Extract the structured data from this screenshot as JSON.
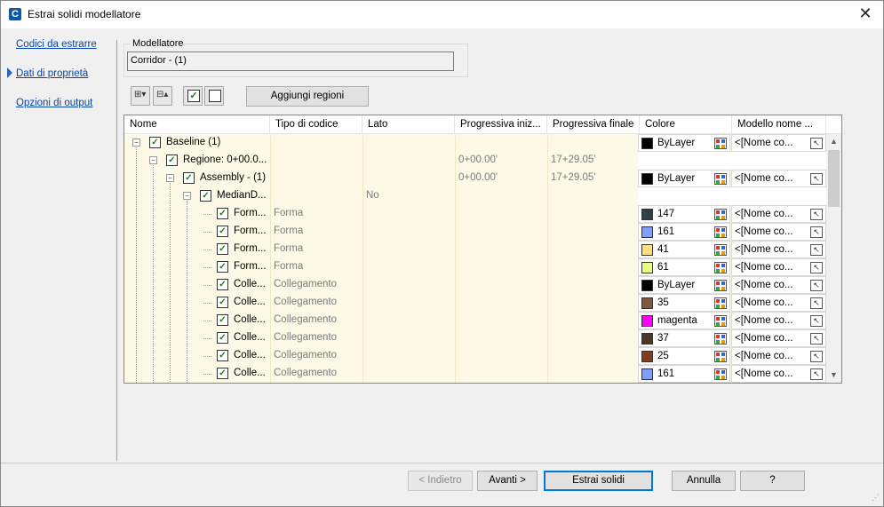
{
  "window": {
    "title": "Estrai solidi modellatore",
    "app_icon_letter": "C",
    "close_glyph": "✕"
  },
  "nav": {
    "items": [
      {
        "label": "Codici da estrarre"
      },
      {
        "label": "Dati di proprietà"
      },
      {
        "label": "Opzioni di output"
      }
    ]
  },
  "modeler": {
    "group_label": "Modellatore",
    "value": "Corridor - (1)"
  },
  "toolbar": {
    "expand_glyph": "⊞▾",
    "collapse_glyph": "⊟▴",
    "check_glyph": "✓",
    "add_regions_label": "Aggiungi regioni"
  },
  "columns": [
    "Nome",
    "Tipo di codice",
    "Lato",
    "Progressiva iniz...",
    "Progressiva finale",
    "Colore",
    "Modello nome ..."
  ],
  "rows": [
    {
      "name": "Baseline (1)",
      "code_type": "",
      "side": "",
      "start": "",
      "end": "",
      "color_name": "ByLayer",
      "color_hex": "#000000",
      "model": "<[Nome co...",
      "has_color": true
    },
    {
      "name": "Regione: 0+00.0...",
      "code_type": "",
      "side": "",
      "start": "0+00.00'",
      "end": "17+29.05'",
      "color_name": "",
      "color_hex": "",
      "model": "",
      "has_color": false
    },
    {
      "name": "Assembly - (1)",
      "code_type": "",
      "side": "",
      "start": "0+00.00'",
      "end": "17+29.05'",
      "color_name": "ByLayer",
      "color_hex": "#000000",
      "model": "<[Nome co...",
      "has_color": true
    },
    {
      "name": "MedianD...",
      "code_type": "",
      "side": "No",
      "start": "",
      "end": "",
      "color_name": "",
      "color_hex": "",
      "model": "",
      "has_color": false
    },
    {
      "name": "Form...",
      "code_type": "Forma",
      "side": "",
      "start": "",
      "end": "",
      "color_name": "147",
      "color_hex": "#2f3f47",
      "model": "<[Nome co...",
      "has_color": true
    },
    {
      "name": "Form...",
      "code_type": "Forma",
      "side": "",
      "start": "",
      "end": "",
      "color_name": "161",
      "color_hex": "#7f9fff",
      "model": "<[Nome co...",
      "has_color": true
    },
    {
      "name": "Form...",
      "code_type": "Forma",
      "side": "",
      "start": "",
      "end": "",
      "color_name": "41",
      "color_hex": "#ffdf7f",
      "model": "<[Nome co...",
      "has_color": true
    },
    {
      "name": "Form...",
      "code_type": "Forma",
      "side": "",
      "start": "",
      "end": "",
      "color_name": "61",
      "color_hex": "#e6ff7f",
      "model": "<[Nome co...",
      "has_color": true
    },
    {
      "name": "Colle...",
      "code_type": "Collegamento",
      "side": "",
      "start": "",
      "end": "",
      "color_name": "ByLayer",
      "color_hex": "#000000",
      "model": "<[Nome co...",
      "has_color": true
    },
    {
      "name": "Colle...",
      "code_type": "Collegamento",
      "side": "",
      "start": "",
      "end": "",
      "color_name": "35",
      "color_hex": "#7f5a3f",
      "model": "<[Nome co...",
      "has_color": true
    },
    {
      "name": "Colle...",
      "code_type": "Collegamento",
      "side": "",
      "start": "",
      "end": "",
      "color_name": "magenta",
      "color_hex": "#ff00ff",
      "model": "<[Nome co...",
      "has_color": true
    },
    {
      "name": "Colle...",
      "code_type": "Collegamento",
      "side": "",
      "start": "",
      "end": "",
      "color_name": "37",
      "color_hex": "#4c3626",
      "model": "<[Nome co...",
      "has_color": true
    },
    {
      "name": "Colle...",
      "code_type": "Collegamento",
      "side": "",
      "start": "",
      "end": "",
      "color_name": "25",
      "color_hex": "#7f3f1f",
      "model": "<[Nome co...",
      "has_color": true
    },
    {
      "name": "Colle...",
      "code_type": "Collegamento",
      "side": "",
      "start": "",
      "end": "",
      "color_name": "161",
      "color_hex": "#7f9fff",
      "model": "<[Nome co...",
      "has_color": true
    }
  ],
  "footer": {
    "back_label": "< Indietro",
    "next_label": "Avanti >",
    "extract_label": "Estrai solidi",
    "cancel_label": "Annulla",
    "help_label": "?"
  },
  "colors": {
    "nav_link": "#0645ad",
    "grid_body": "#fdf9e6",
    "default_button_border": "#0078d7",
    "check": "#1a7a1a"
  }
}
